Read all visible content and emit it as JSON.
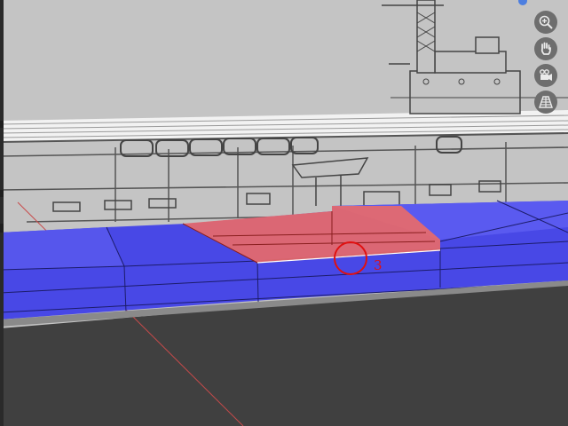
{
  "viewport": {
    "background_color": "#404040",
    "reference_image_color": "#c4c4c4",
    "selected_face_color": "#e86a6a",
    "mesh_face_color": "#4848e6"
  },
  "navigation": {
    "zoom_icon": "zoom-magnifier-icon",
    "pan_icon": "hand-icon",
    "camera_icon": "camera-icon",
    "perspective_icon": "grid-perspective-icon"
  },
  "cursor": {
    "label": "3"
  }
}
